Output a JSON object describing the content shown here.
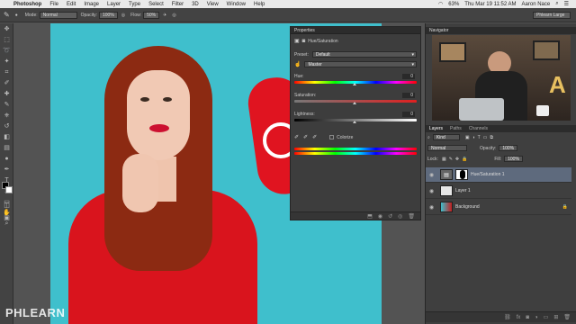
{
  "menubar": {
    "apple": "",
    "app_name": "Photoshop",
    "items": [
      "File",
      "Edit",
      "Image",
      "Layer",
      "Type",
      "Select",
      "Filter",
      "3D",
      "View",
      "Window",
      "Help"
    ],
    "battery": "63%",
    "clock": "Thu Mar 19  11:52 AM",
    "user": "Aaron Nace"
  },
  "options": {
    "mode_label": "Mode:",
    "mode_value": "Normal",
    "opacity_label": "Opacity:",
    "opacity_value": "100%",
    "flow_label": "Flow:",
    "flow_value": "50%",
    "workspace": "Phlearn Large"
  },
  "properties": {
    "tab": "Properties",
    "title": "Hue/Saturation",
    "preset_label": "Preset:",
    "preset_value": "Default",
    "channel_value": "Master",
    "hue_label": "Hue:",
    "hue_value": "0",
    "saturation_label": "Saturation:",
    "saturation_value": "0",
    "lightness_label": "Lightness:",
    "lightness_value": "0",
    "colorize_label": "Colorize"
  },
  "navigator": {
    "tab": "Navigator"
  },
  "layers": {
    "tabs": [
      "Layers",
      "Paths",
      "Channels"
    ],
    "kind_label": "Kind",
    "blend_value": "Normal",
    "opacity_label": "Opacity:",
    "opacity_value": "100%",
    "lock_label": "Lock:",
    "fill_label": "Fill:",
    "fill_value": "100%",
    "items": [
      {
        "name": "Hue/Saturation 1"
      },
      {
        "name": "Layer 1"
      },
      {
        "name": "Background"
      }
    ]
  },
  "watermark": "PHLEARN",
  "colors": {
    "accent_sky": "#3fbfcc",
    "selected_layer": "#5e6a7d"
  }
}
